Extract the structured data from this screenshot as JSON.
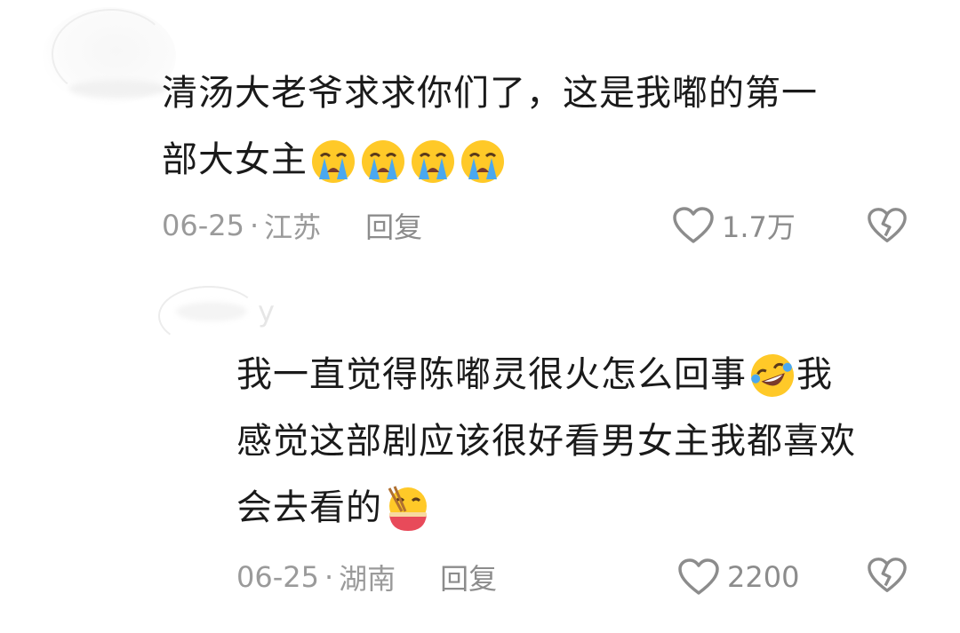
{
  "comments": [
    {
      "lines": [
        "清汤大老爷求求你们了，这是我嘟的第一",
        "部大女主"
      ],
      "emojis": [
        "crying-face-emoji",
        "crying-face-emoji",
        "crying-face-emoji",
        "crying-face-emoji"
      ],
      "date": "06-25",
      "separator": "·",
      "location": "江苏",
      "reply_label": "回复",
      "likes": "1.7万"
    },
    {
      "lines": [
        "我一直觉得陈嘟灵很火怎么回事",
        "我",
        "感觉这部剧应该很好看男女主我都喜欢",
        "会去看的"
      ],
      "emojis": [
        "rolling-laughing-emoji",
        "eating-noodles-emoji"
      ],
      "date": "06-25",
      "separator": "·",
      "location": "湖南",
      "reply_label": "回复",
      "likes": "2200"
    }
  ],
  "icons": {
    "like": "heart-outline-icon",
    "dislike": "broken-heart-icon"
  },
  "colors": {
    "text": "#1a1a1a",
    "meta": "#9a9a9a",
    "emoji_yellow": "#ffc928",
    "tear_blue": "#4aa8f0"
  }
}
